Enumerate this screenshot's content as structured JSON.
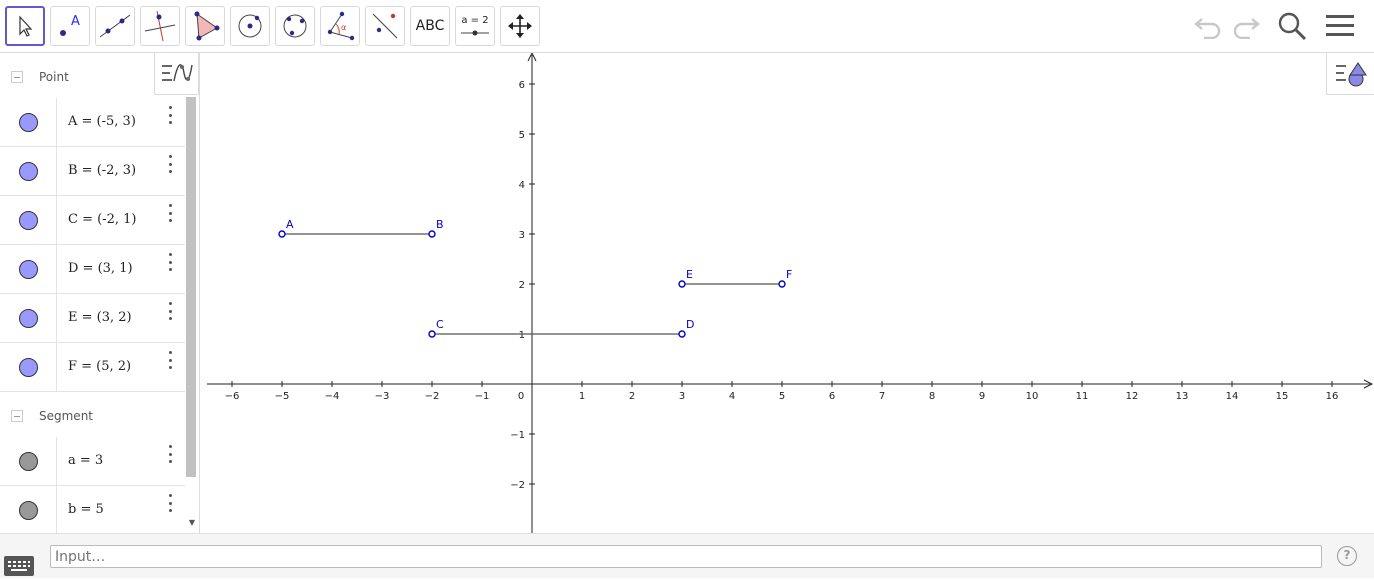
{
  "toolbar": {
    "tools": [
      {
        "name": "move",
        "icon": "cursor-arrow-icon"
      },
      {
        "name": "point",
        "icon": "point-icon",
        "label": "A"
      },
      {
        "name": "line",
        "icon": "line-icon"
      },
      {
        "name": "perpendicular",
        "icon": "perpendicular-line-icon"
      },
      {
        "name": "polygon",
        "icon": "polygon-icon"
      },
      {
        "name": "circle",
        "icon": "circle-center-point-icon"
      },
      {
        "name": "conic",
        "icon": "circle-three-points-icon"
      },
      {
        "name": "angle",
        "icon": "angle-icon",
        "label": "α"
      },
      {
        "name": "reflect",
        "icon": "reflect-line-icon"
      },
      {
        "name": "text",
        "icon": "text-icon",
        "label": "ABC"
      },
      {
        "name": "slider",
        "icon": "slider-icon",
        "label": "a = 2"
      },
      {
        "name": "move-graphics",
        "icon": "move-graphics-icon"
      }
    ],
    "right": [
      "undo-icon",
      "redo-icon",
      "search-icon",
      "menu-icon"
    ]
  },
  "algebra": {
    "groups": [
      {
        "label": "Point",
        "items": [
          {
            "text": "A = (-5, 3)",
            "color": "#9999ff"
          },
          {
            "text": "B = (-2, 3)",
            "color": "#9999ff"
          },
          {
            "text": "C = (-2, 1)",
            "color": "#9999ff"
          },
          {
            "text": "D = (3, 1)",
            "color": "#9999ff"
          },
          {
            "text": "E = (3, 2)",
            "color": "#9999ff"
          },
          {
            "text": "F = (5, 2)",
            "color": "#9999ff"
          }
        ]
      },
      {
        "label": "Segment",
        "items": [
          {
            "text": "a = 3",
            "color": "#999999"
          },
          {
            "text": "b = 5",
            "color": "#999999"
          }
        ]
      }
    ]
  },
  "graphics": {
    "x_ticks": [
      "−6",
      "−5",
      "−4",
      "−3",
      "−2",
      "−1",
      "0",
      "1",
      "2",
      "3",
      "4",
      "5",
      "6",
      "7",
      "8",
      "9",
      "10",
      "11",
      "12",
      "13",
      "14",
      "15",
      "16"
    ],
    "y_ticks": [
      "6",
      "5",
      "4",
      "3",
      "2",
      "1",
      "−1",
      "−2"
    ],
    "points": [
      {
        "label": "A",
        "x": -5,
        "y": 3
      },
      {
        "label": "B",
        "x": -2,
        "y": 3
      },
      {
        "label": "C",
        "x": -2,
        "y": 1
      },
      {
        "label": "D",
        "x": 3,
        "y": 1
      },
      {
        "label": "E",
        "x": 3,
        "y": 2
      },
      {
        "label": "F",
        "x": 5,
        "y": 2
      }
    ],
    "segments": [
      [
        "A",
        "B"
      ],
      [
        "C",
        "D"
      ],
      [
        "E",
        "F"
      ]
    ],
    "point_color": "#0000cc",
    "segment_color": "#555555"
  },
  "input": {
    "placeholder": "Input…",
    "help": "?"
  }
}
